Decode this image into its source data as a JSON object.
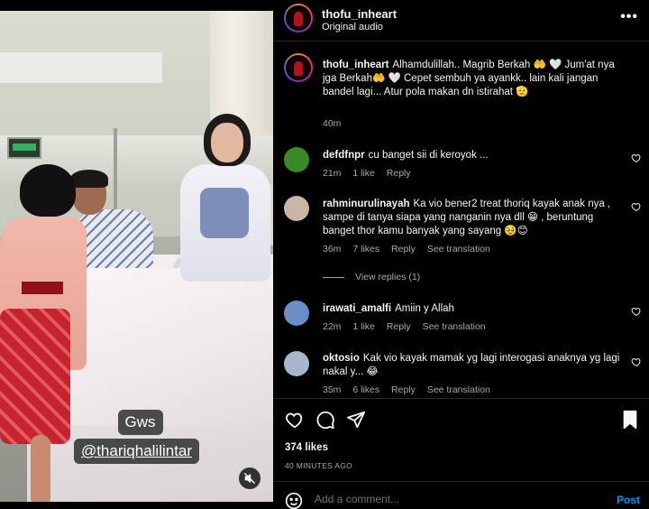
{
  "video": {
    "caption_line1": "Gws",
    "caption_line2": "@thariqhalilintar",
    "mute_icon": "speaker-muted-icon"
  },
  "header": {
    "username": "thofu_inheart",
    "audio": "Original audio",
    "more_icon": "more-horizontal-icon",
    "more_label": "•••"
  },
  "caption": {
    "username": "thofu_inheart",
    "text": "Alhamdulillah.. Magrib Berkah 🤲 🤍 Jum'at nya jga Berkah🤲 🤍 Cepet sembuh ya ayankk.. lain kali jangan bandel lagi... Atur pola makan dn istirahat 🫡",
    "time": "40m"
  },
  "comments": [
    {
      "username": "defdfnpr",
      "text": "cu banget sii di keroyok ...",
      "time": "21m",
      "likes": "1 like",
      "reply": "Reply",
      "translation": "",
      "avatar_color": "#3a8a2a"
    },
    {
      "username": "rahminurulinayah",
      "text": "Ka vio bener2 treat thoriq kayak anak nya , sampe di tanya siapa yang nanganin nya dll 😁 , beruntung banget thor kamu banyak yang sayang 🥹😊",
      "time": "36m",
      "likes": "7 likes",
      "reply": "Reply",
      "translation": "See translation",
      "avatar_color": "#c9b6a6",
      "view_replies": "View replies (1)"
    },
    {
      "username": "irawati_amalfi",
      "text": "Amiin y Allah",
      "time": "22m",
      "likes": "1 like",
      "reply": "Reply",
      "translation": "See translation",
      "avatar_color": "#6a8fc6"
    },
    {
      "username": "oktosio",
      "text": "Kak vio kayak mamak yg lagi interogasi anaknya yg lagi nakal y... 😂",
      "time": "35m",
      "likes": "6 likes",
      "reply": "Reply",
      "translation": "See translation",
      "avatar_color": "#a7b6c8"
    }
  ],
  "actions": {
    "like_icon": "heart-icon",
    "comment_icon": "comment-icon",
    "share_icon": "send-icon",
    "save_icon": "bookmark-icon",
    "likes": "374 likes",
    "time_ago": "40 MINUTES AGO"
  },
  "add_comment": {
    "emoji_icon": "emoji-icon",
    "placeholder": "Add a comment...",
    "post_label": "Post"
  },
  "colors": {
    "background": "#000000",
    "text": "#f5f5f5",
    "muted": "#a8a8a8",
    "accent": "#0095f6"
  }
}
